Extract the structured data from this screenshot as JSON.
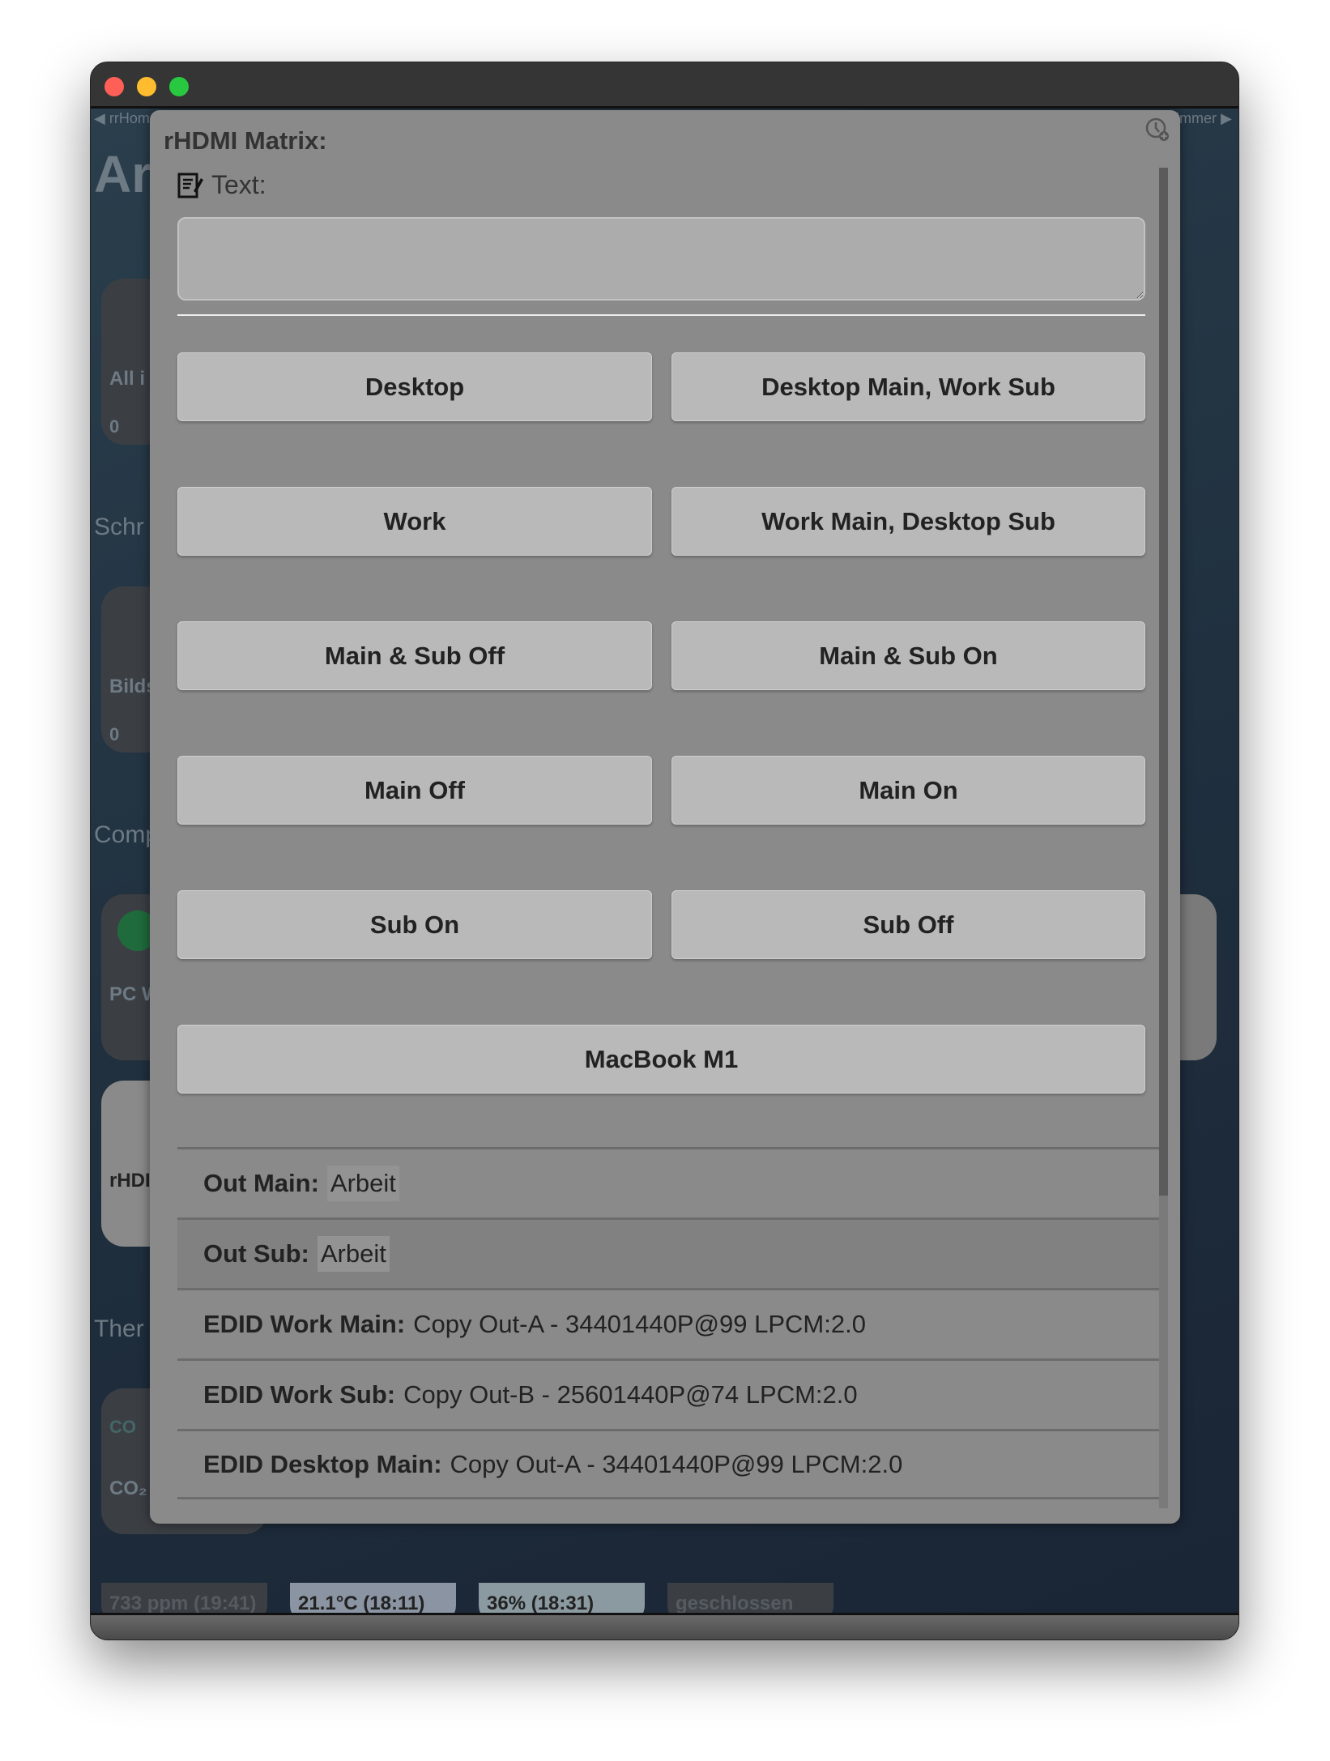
{
  "window": {
    "traffic_lights": {
      "close": "#fe5f57",
      "minimize": "#febc2e",
      "zoom": "#28c840"
    }
  },
  "background": {
    "nav_left": "◀ rrHom",
    "nav_right": "immer ▶",
    "page_title": "Ar",
    "sections": [
      "Schr",
      "Comp",
      "Ther"
    ],
    "tiles": [
      {
        "label": "All i",
        "value": "0"
      },
      {
        "label": "Bilds",
        "value": "0"
      },
      {
        "label": "PC W"
      },
      {
        "label": "rHDI"
      },
      {
        "label": "CO₂",
        "badge": "CO"
      }
    ],
    "status_pills": [
      "733 ppm (19:41)",
      "21.1°C (18:11)",
      "36% (18:31)",
      "geschlossen"
    ]
  },
  "modal": {
    "title": "rHDMI Matrix:",
    "history_icon": "clock-plus-icon",
    "text_label": "Text:",
    "text_icon": "signed-document-icon",
    "text_value": "",
    "buttons": [
      "Desktop",
      "Desktop Main, Work Sub",
      "Work",
      "Work Main, Desktop Sub",
      "Main & Sub Off",
      "Main & Sub On",
      "Main Off",
      "Main On",
      "Sub On",
      "Sub Off",
      "MacBook M1"
    ],
    "rows": [
      {
        "label": "Out Main:",
        "value": "Arbeit",
        "highlight": true
      },
      {
        "label": "Out Sub:",
        "value": "Arbeit",
        "highlight": true
      },
      {
        "label": "EDID Work Main:",
        "value": "Copy Out-A - 34401440P@99 LPCM:2.0"
      },
      {
        "label": "EDID Work Sub:",
        "value": "Copy Out-B - 25601440P@74 LPCM:2.0"
      },
      {
        "label": "EDID Desktop Main:",
        "value": "Copy Out-A - 34401440P@99 LPCM:2.0"
      }
    ]
  }
}
